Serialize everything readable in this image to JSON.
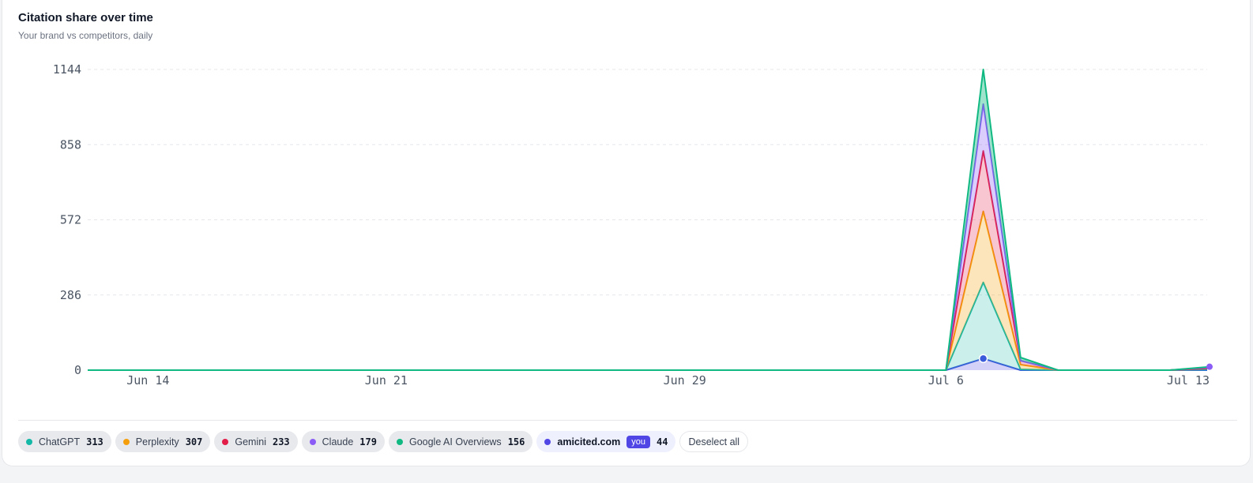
{
  "card": {
    "title": "Citation share over time",
    "subtitle": "Your brand vs competitors, daily"
  },
  "legend": {
    "items": [
      {
        "name": "ChatGPT",
        "total": "313",
        "color": "#14b8a6"
      },
      {
        "name": "Perplexity",
        "total": "307",
        "color": "#f59e0b"
      },
      {
        "name": "Gemini",
        "total": "233",
        "color": "#e11d48"
      },
      {
        "name": "Claude",
        "total": "179",
        "color": "#8b5cf6"
      },
      {
        "name": "Google AI Overviews",
        "total": "156",
        "color": "#10b981"
      },
      {
        "name": "amicited.com",
        "total": "44",
        "color": "#4f46e5",
        "you_badge": "you"
      }
    ],
    "deselect_label": "Deselect all"
  },
  "chart_data": {
    "type": "area",
    "stacked": true,
    "x_start": "Jun 13",
    "x_end": "Jul 13",
    "x_tick_labels": [
      "Jun 14",
      "Jun 21",
      "Jun 29",
      "Jul 6",
      "Jul 13"
    ],
    "y_ticks": [
      0,
      286,
      572,
      858,
      1144
    ],
    "ylim": [
      0,
      1144
    ],
    "grid": "horizontal dashed",
    "series": [
      {
        "name": "amicited.com",
        "color": "#3b5bdb",
        "values": {
          "Jul 7": 44
        }
      },
      {
        "name": "ChatGPT",
        "color": "#14b8a6",
        "values": {
          "Jul 7": 290,
          "Jul 8": 3,
          "Jul 13": 3
        }
      },
      {
        "name": "Perplexity",
        "color": "#f59e0b",
        "values": {
          "Jul 7": 270,
          "Jul 8": 18,
          "Jul 13": 4
        }
      },
      {
        "name": "Gemini",
        "color": "#e11d48",
        "values": {
          "Jul 7": 230,
          "Jul 8": 15
        }
      },
      {
        "name": "Claude",
        "color": "#8b5cf6",
        "values": {
          "Jul 7": 178,
          "Jul 13": 3
        }
      },
      {
        "name": "Google AI Overviews",
        "color": "#10b981",
        "values": {
          "Jul 7": 132,
          "Jul 8": 12,
          "Jul 13": 2
        }
      }
    ]
  }
}
